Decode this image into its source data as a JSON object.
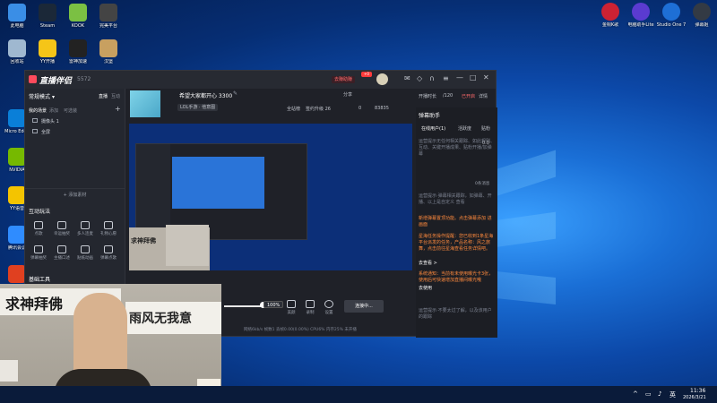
{
  "desktop_left": [
    {
      "label": "此电脑",
      "color": "#3a8ee6"
    },
    {
      "label": "Steam",
      "color": "#1b2838"
    },
    {
      "label": "KOOK",
      "color": "#7bc043"
    },
    {
      "label": "完美平台",
      "color": "#444444"
    },
    {
      "label": "回收站",
      "color": "#9fb8d0"
    },
    {
      "label": "YY开播",
      "color": "#f5c518"
    },
    {
      "label": "雷神加速",
      "color": "#222222"
    },
    {
      "label": "汉堡",
      "color": "#c8a060"
    },
    {
      "label": "Micro Edge",
      "color": "#0a7fd8"
    },
    {
      "label": "NVIDIA",
      "color": "#76b900"
    },
    {
      "label": "YY语音",
      "color": "#f4c400"
    },
    {
      "label": "腾讯会议",
      "color": "#2f8cff"
    },
    {
      "label": "",
      "color": "#e04020"
    }
  ],
  "desktop_right": [
    {
      "label": "金桐K歌",
      "color": "#cc2233"
    },
    {
      "label": "电脑助手Lite",
      "color": "#5a3bd0"
    },
    {
      "label": "Studio One 7",
      "color": "#1e6fd6"
    },
    {
      "label": "弹幕姬",
      "color": "#333a44"
    }
  ],
  "app": {
    "name": "直播伴侣",
    "version": "5572",
    "stream_title": "希望大家都开心 3300",
    "tag": "LOL手游 · 他意图",
    "activity": "全站榜",
    "fans": "签约升级 26",
    "likes": "0",
    "hearts": "83835",
    "ad_label": "去赚助赚",
    "ad_badge": "+0",
    "live_time_label": "开播时长",
    "live_time": "/120",
    "pk_label": "已开启",
    "detail_label": "详情"
  },
  "sidebar": {
    "mode": "常规模式",
    "mode_caret": "▾",
    "tabs": [
      "直播",
      "互动"
    ],
    "scene_tabs": [
      "我的场景",
      "添加",
      "可选装"
    ],
    "scenes": [
      "摄像头 1",
      "全屏"
    ],
    "add_source": "+ 添加素材",
    "section_interact": "互动玩法",
    "tools_row1": [
      "点歌",
      "幸运抽奖",
      "多人连麦",
      "礼物心愿"
    ],
    "tools_row2": [
      "弹幕抽奖",
      "主播口述",
      "贴纸动画",
      "弹幕点歌"
    ],
    "section_basic": "基础工具",
    "add_icon": "+"
  },
  "controls": {
    "volume": "100%",
    "icons": [
      "美颜",
      "录制",
      "设置"
    ],
    "connect_button": "连接中..."
  },
  "status": {
    "text": "网络6kb/s   帧数1   丢帧0.00(0.00%)   CPU6%   内存25%   未开播"
  },
  "right_panel": {
    "title": "弹幕助手",
    "tabs": [
      "在线用户(1)",
      "活跃度",
      "贴粉"
    ],
    "empty_online": "运营提示无任何相关跟踪、如此规则、互动、关键开播成果、贴粉开播/加弹幕",
    "balance": "0.0",
    "count_label": "0条消息",
    "messages": [
      {
        "text": "运营提示·弹幕相关跟踪，如弹幕、开播、以上是自定义 查看",
        "color": "#7c8290"
      },
      {
        "text": "新增弹幕置顶功能。点击弹幕添加 进画面",
        "color": "#ff8a3d"
      },
      {
        "text": "星海任务操作提醒：您已收到1条星海平台派发的任务，产品名称：风之旅舞，点击前往星海查看任务详情吧。",
        "color": "#ff8a3d"
      },
      {
        "text": "去查看 >",
        "color": "#ffffff"
      },
      {
        "text": "系统通知：当前有未使用曝光卡3张，使用后可快速增加直播间曝光哦",
        "color": "#ff8a3d"
      },
      {
        "text": "去使用",
        "color": "#ffffff"
      },
      {
        "text": "运营提示·不要太过了解，以及该用户的跟踪",
        "color": "#7c8290"
      }
    ]
  },
  "webcam_banner": "求神拜佛",
  "calligraphy": "雨风无我意",
  "small_overlay": "求神拜佛",
  "taskbar": {
    "time": "11:36",
    "date": "2026/3/21",
    "lang": "英"
  }
}
